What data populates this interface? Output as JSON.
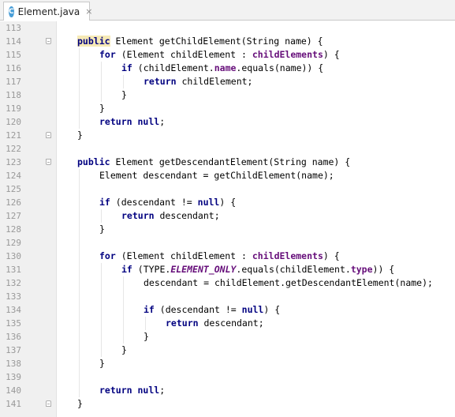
{
  "tab": {
    "icon_letter": "C",
    "file_name": "Element.java",
    "close_glyph": "×"
  },
  "lines": [
    {
      "n": "113",
      "fold": "",
      "indent": 0,
      "tokens": []
    },
    {
      "n": "114",
      "fold": "start",
      "indent": 0,
      "tokens": [
        {
          "t": "public",
          "c": "kw-hl"
        },
        {
          "t": " Element getChildElement(String name) {"
        }
      ]
    },
    {
      "n": "115",
      "fold": "",
      "indent": 1,
      "tokens": [
        {
          "t": "for",
          "c": "kw"
        },
        {
          "t": " (Element childElement : "
        },
        {
          "t": "childElements",
          "c": "fld"
        },
        {
          "t": ") {"
        }
      ]
    },
    {
      "n": "116",
      "fold": "",
      "indent": 2,
      "tokens": [
        {
          "t": "if",
          "c": "kw"
        },
        {
          "t": " (childElement."
        },
        {
          "t": "name",
          "c": "fld"
        },
        {
          "t": ".equals(name)) {"
        }
      ]
    },
    {
      "n": "117",
      "fold": "",
      "indent": 3,
      "tokens": [
        {
          "t": "return",
          "c": "kw"
        },
        {
          "t": " childElement;"
        }
      ]
    },
    {
      "n": "118",
      "fold": "",
      "indent": 2,
      "tokens": [
        {
          "t": "}"
        }
      ]
    },
    {
      "n": "119",
      "fold": "",
      "indent": 1,
      "tokens": [
        {
          "t": "}"
        }
      ]
    },
    {
      "n": "120",
      "fold": "",
      "indent": 1,
      "tokens": [
        {
          "t": "return",
          "c": "kw"
        },
        {
          "t": " "
        },
        {
          "t": "null",
          "c": "kw"
        },
        {
          "t": ";"
        }
      ]
    },
    {
      "n": "121",
      "fold": "end",
      "indent": 0,
      "tokens": [
        {
          "t": "}"
        }
      ]
    },
    {
      "n": "122",
      "fold": "",
      "indent": 0,
      "tokens": []
    },
    {
      "n": "123",
      "fold": "start",
      "indent": 0,
      "tokens": [
        {
          "t": "public",
          "c": "kw"
        },
        {
          "t": " Element getDescendantElement(String name) {"
        }
      ]
    },
    {
      "n": "124",
      "fold": "",
      "indent": 1,
      "tokens": [
        {
          "t": "Element descendant = getChildElement(name);"
        }
      ]
    },
    {
      "n": "125",
      "fold": "",
      "indent": 0,
      "tokens": []
    },
    {
      "n": "126",
      "fold": "",
      "indent": 1,
      "tokens": [
        {
          "t": "if",
          "c": "kw"
        },
        {
          "t": " (descendant != "
        },
        {
          "t": "null",
          "c": "kw"
        },
        {
          "t": ") {"
        }
      ]
    },
    {
      "n": "127",
      "fold": "",
      "indent": 2,
      "tokens": [
        {
          "t": "return",
          "c": "kw"
        },
        {
          "t": " descendant;"
        }
      ]
    },
    {
      "n": "128",
      "fold": "",
      "indent": 1,
      "tokens": [
        {
          "t": "}"
        }
      ]
    },
    {
      "n": "129",
      "fold": "",
      "indent": 0,
      "tokens": []
    },
    {
      "n": "130",
      "fold": "",
      "indent": 1,
      "tokens": [
        {
          "t": "for",
          "c": "kw"
        },
        {
          "t": " (Element childElement : "
        },
        {
          "t": "childElements",
          "c": "fld"
        },
        {
          "t": ") {"
        }
      ]
    },
    {
      "n": "131",
      "fold": "",
      "indent": 2,
      "tokens": [
        {
          "t": "if",
          "c": "kw"
        },
        {
          "t": " (TYPE."
        },
        {
          "t": "ELEMENT_ONLY",
          "c": "sfld"
        },
        {
          "t": ".equals(childElement."
        },
        {
          "t": "type",
          "c": "fld"
        },
        {
          "t": ")) {"
        }
      ]
    },
    {
      "n": "132",
      "fold": "",
      "indent": 3,
      "tokens": [
        {
          "t": "descendant = childElement.getDescendantElement(name);"
        }
      ]
    },
    {
      "n": "133",
      "fold": "",
      "indent": 0,
      "tokens": []
    },
    {
      "n": "134",
      "fold": "",
      "indent": 3,
      "tokens": [
        {
          "t": "if",
          "c": "kw"
        },
        {
          "t": " (descendant != "
        },
        {
          "t": "null",
          "c": "kw"
        },
        {
          "t": ") {"
        }
      ]
    },
    {
      "n": "135",
      "fold": "",
      "indent": 4,
      "tokens": [
        {
          "t": "return",
          "c": "kw"
        },
        {
          "t": " descendant;"
        }
      ]
    },
    {
      "n": "136",
      "fold": "",
      "indent": 3,
      "tokens": [
        {
          "t": "}"
        }
      ]
    },
    {
      "n": "137",
      "fold": "",
      "indent": 2,
      "tokens": [
        {
          "t": "}"
        }
      ]
    },
    {
      "n": "138",
      "fold": "",
      "indent": 1,
      "tokens": [
        {
          "t": "}"
        }
      ]
    },
    {
      "n": "139",
      "fold": "",
      "indent": 0,
      "tokens": []
    },
    {
      "n": "140",
      "fold": "",
      "indent": 1,
      "tokens": [
        {
          "t": "return",
          "c": "kw"
        },
        {
          "t": " "
        },
        {
          "t": "null",
          "c": "kw"
        },
        {
          "t": ";"
        }
      ]
    },
    {
      "n": "141",
      "fold": "end",
      "indent": 0,
      "tokens": [
        {
          "t": "}"
        }
      ]
    }
  ]
}
